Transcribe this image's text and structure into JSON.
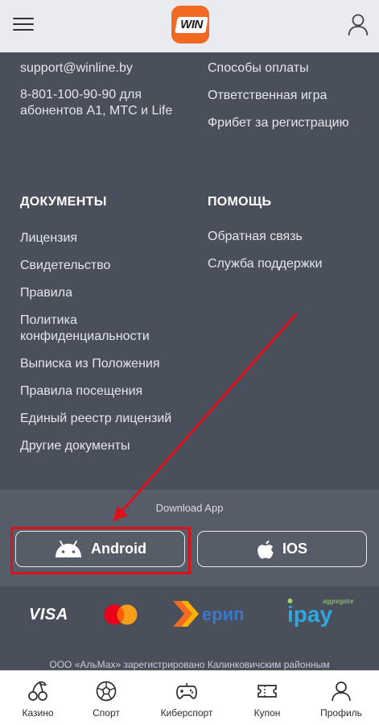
{
  "header": {
    "menu_icon": "hamburger-icon",
    "logo_text": "WIN",
    "profile_icon": "user-icon",
    "brand_color": "#f26a21"
  },
  "contacts": {
    "email": "support@winline.by",
    "phone_line1": "8-801-100-90-90 для",
    "phone_line2": "абонентов А1, МТС и Life"
  },
  "info_links": [
    "Способы оплаты",
    "Ответственная игра",
    "Фрибет за регистрацию"
  ],
  "documents": {
    "heading": "ДОКУМЕНТЫ",
    "items": [
      "Лицензия",
      "Свидетельство",
      "Правила",
      "Политика",
      "конфиденциальности",
      "Выписка из Положения",
      "Правила посещения",
      "Единый реестр лицензий",
      "Другие документы"
    ]
  },
  "help": {
    "heading": "ПОМОЩЬ",
    "items": [
      "Обратная связь",
      "Служба поддержки"
    ]
  },
  "download": {
    "label": "Download App",
    "android_label": "Android",
    "ios_label": "IOS",
    "highlight_color": "#e0101a"
  },
  "payments": {
    "visa": "VISA",
    "erip": "ерип",
    "ipay": "ipay",
    "ipay_sub": "aggregator",
    "legal_text": "ООО «АльМах» зарегистрировано Калинковичским районным"
  },
  "bottom_nav": [
    {
      "label": "Казино",
      "icon": "cherries-icon"
    },
    {
      "label": "Спорт",
      "icon": "soccer-ball-icon"
    },
    {
      "label": "Киберспорт",
      "icon": "gamepad-icon"
    },
    {
      "label": "Купон",
      "icon": "ticket-icon"
    },
    {
      "label": "Профиль",
      "icon": "user-icon"
    }
  ]
}
